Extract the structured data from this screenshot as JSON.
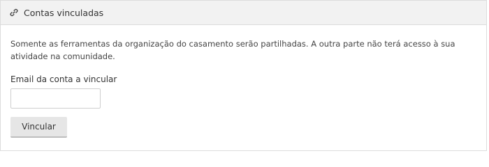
{
  "panel": {
    "title": "Contas vinculadas",
    "header_icon": "link-icon",
    "description": "Somente as ferramentas da organização do casamento serão partilhadas. A outra parte não terá acesso à sua atividade na comunidade.",
    "email_label": "Email da conta a vincular",
    "email_value": "",
    "email_placeholder": "",
    "button_label": "Vincular"
  },
  "colors": {
    "header_bg": "#f2f2f2",
    "border": "#dcdcdc",
    "button_bg": "#e6e6e6",
    "text": "#333333"
  }
}
